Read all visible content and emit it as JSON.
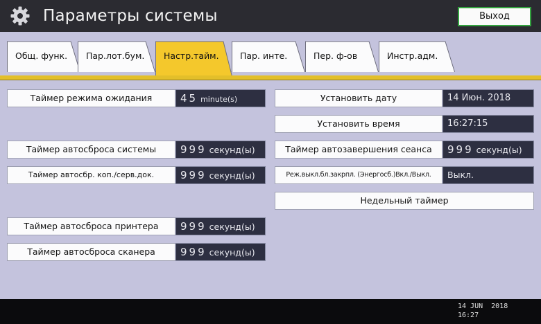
{
  "header": {
    "title": "Параметры системы",
    "exit_label": "Выход"
  },
  "tabs": [
    {
      "label": "Общ. функ.",
      "active": false
    },
    {
      "label": "Пар.лот.бум.",
      "active": false
    },
    {
      "label": "Настр.тайм.",
      "active": true
    },
    {
      "label": "Пар. инте.",
      "active": false
    },
    {
      "label": "Пер. ф-ов",
      "active": false
    },
    {
      "label": "Инстр.адм.",
      "active": false
    }
  ],
  "left": {
    "standby": {
      "label": "Таймер режима ожидания",
      "num": "45",
      "unit": "minute(s)"
    },
    "system_reset": {
      "label": "Таймер автосброса системы",
      "num": "999",
      "unit": "секунд(ы)"
    },
    "copier_reset": {
      "label": "Таймер автосбр. коп./серв.док.",
      "num": "999",
      "unit": "секунд(ы)"
    },
    "printer_reset": {
      "label": "Таймер автосброса принтера",
      "num": "999",
      "unit": "секунд(ы)"
    },
    "scanner_reset": {
      "label": "Таймер автосброса сканера",
      "num": "999",
      "unit": "секунд(ы)"
    }
  },
  "right": {
    "set_date": {
      "label": "Установить дату",
      "value": "14 Июн. 2018"
    },
    "set_time": {
      "label": "Установить время",
      "value": "16:27:15"
    },
    "auto_logout": {
      "label": "Таймер автозавершения сеанса",
      "num": "999",
      "unit": "секунд(ы)"
    },
    "energy_lock": {
      "label": "Реж.выкл.бл.закрпл. (Энергосб.)Вкл./Выкл.",
      "value": "Выкл."
    },
    "weekly_timer": {
      "label": "Недельный таймер"
    }
  },
  "footer": {
    "date": "14 JUN  2018",
    "time": "16:27"
  },
  "colors": {
    "header_bg": "#2b2b31",
    "background": "#c4c3dd",
    "active_tab": "#f4c82c",
    "accent_line": "#e3bf2a",
    "value_bg": "#2d2f41",
    "exit_border": "#33a33f"
  }
}
